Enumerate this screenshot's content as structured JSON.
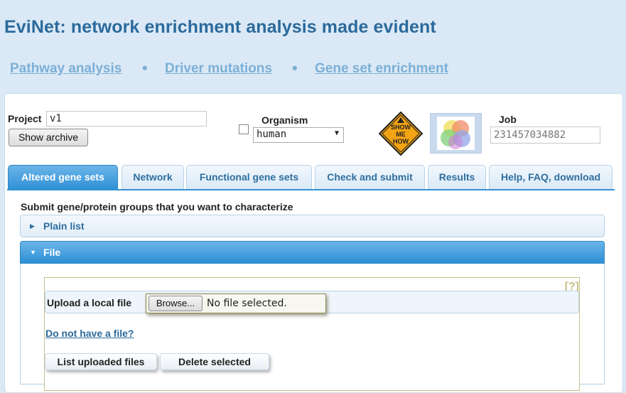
{
  "app": {
    "title": "EviNet: network enrichment analysis made evident"
  },
  "topnav": {
    "items": [
      {
        "label": "Pathway analysis"
      },
      {
        "label": "Driver mutations"
      },
      {
        "label": "Gene set enrichment"
      }
    ],
    "separator": "•"
  },
  "project": {
    "label": "Project",
    "value": "v1",
    "show_archive_label": "Show archive"
  },
  "organism": {
    "label": "Organism",
    "selected": "human",
    "checkbox_checked": false
  },
  "show_me_how": {
    "line1": "SHOW",
    "line2": "ME",
    "line3": "HOW"
  },
  "job": {
    "label": "Job",
    "placeholder": "231457034882"
  },
  "tabs": [
    {
      "label": "Altered gene sets",
      "active": true
    },
    {
      "label": "Network"
    },
    {
      "label": "Functional gene sets"
    },
    {
      "label": "Check and submit"
    },
    {
      "label": "Results"
    },
    {
      "label": "Help, FAQ, download"
    }
  ],
  "main": {
    "instruction": "Submit gene/protein groups that you want to characterize",
    "accordion": [
      {
        "label": "Plain list",
        "expanded": false
      },
      {
        "label": "File",
        "expanded": true
      }
    ],
    "file_panel": {
      "help": "[?]",
      "upload_label": "Upload a local file",
      "browse_label": "Browse...",
      "file_status": "No file selected.",
      "no_file_link": "Do not have a file?",
      "list_button": "List uploaded files",
      "delete_button": "Delete selected"
    }
  },
  "colors": {
    "title": "#2b6a9b",
    "nav_link": "#7cafd6",
    "active_tab": "#2d8fd6",
    "background": "#dbe9f6"
  }
}
